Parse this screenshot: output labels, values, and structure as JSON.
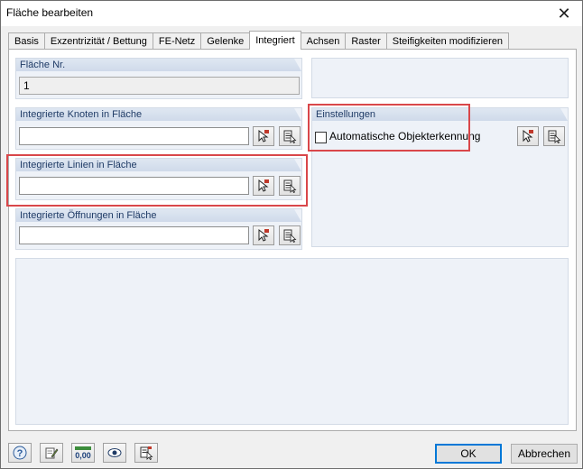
{
  "window": {
    "title": "Fläche bearbeiten",
    "close_glyph": "✕"
  },
  "tabs": [
    {
      "label": "Basis"
    },
    {
      "label": "Exzentrizität / Bettung"
    },
    {
      "label": "FE-Netz"
    },
    {
      "label": "Gelenke"
    },
    {
      "label": "Integriert",
      "active": true
    },
    {
      "label": "Achsen"
    },
    {
      "label": "Raster"
    },
    {
      "label": "Steifigkeiten modifizieren"
    }
  ],
  "flaeche_nr": {
    "title": "Fläche Nr.",
    "value": "1"
  },
  "knoten": {
    "title": "Integrierte Knoten in Fläche",
    "value": ""
  },
  "linien": {
    "title": "Integrierte Linien in Fläche",
    "value": ""
  },
  "oeffnungen": {
    "title": "Integrierte Öffnungen in Fläche",
    "value": ""
  },
  "einstellungen": {
    "title": "Einstellungen",
    "auto_label": "Automatische Objekterkennung",
    "auto_checked": false
  },
  "footer": {
    "ok_label": "OK",
    "cancel_label": "Abbrechen",
    "tools": [
      "help-icon",
      "edit-icon",
      "units-icon",
      "view-icon",
      "pick-icon"
    ],
    "units_text": "0,00"
  },
  "colors": {
    "highlight": "#d9474a",
    "group_bg": "#eef2f8",
    "group_title": "#1f3b66",
    "default_button_border": "#0078d7"
  }
}
